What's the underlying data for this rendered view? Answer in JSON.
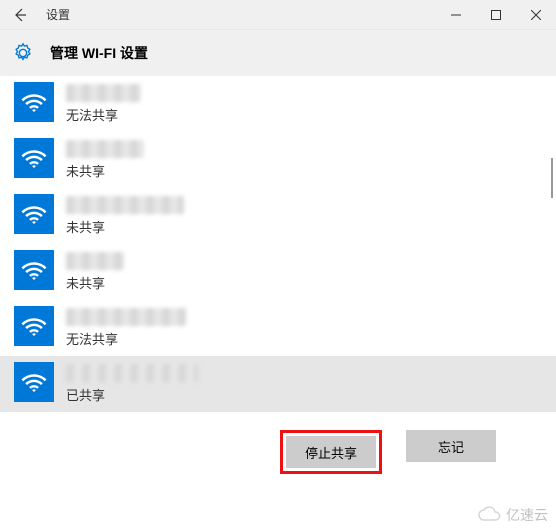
{
  "titlebar": {
    "title": "设置"
  },
  "header": {
    "title": "管理 WI-FI 设置"
  },
  "networks": [
    {
      "status": "无法共享",
      "blur_width": 75
    },
    {
      "status": "未共享",
      "blur_width": 78
    },
    {
      "status": "未共享",
      "blur_width": 118
    },
    {
      "status": "未共享",
      "blur_width": 58
    },
    {
      "status": "无法共享",
      "blur_width": 120
    },
    {
      "status": "已共享",
      "blur_width": 132,
      "selected": true
    }
  ],
  "actions": {
    "stop_share": "停止共享",
    "forget": "忘记"
  },
  "watermark": "亿速云"
}
